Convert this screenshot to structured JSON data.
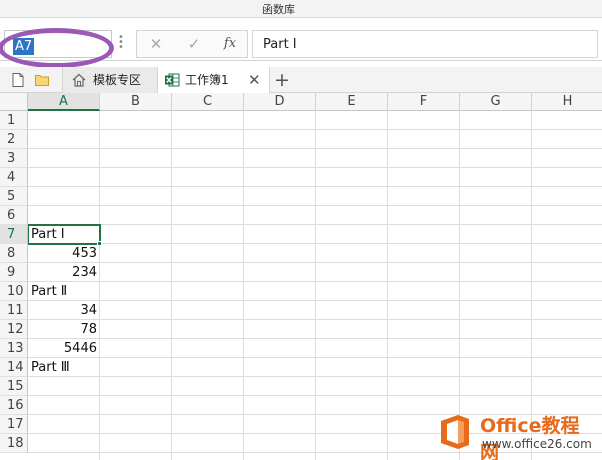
{
  "ribbon": {
    "title": "函数库"
  },
  "formula_bar": {
    "name_box": "A7",
    "more_icon": "more-vertical-icon",
    "cancel_icon": "close-icon",
    "enter_icon": "check-icon",
    "fx_label": "fx",
    "formula_value": "Part Ⅰ",
    "highlight_color": "#9b59b6"
  },
  "tabs": {
    "new_icon": "new-document-icon",
    "open_icon": "folder-icon",
    "items": [
      {
        "label": "模板专区",
        "icon": "home-icon"
      },
      {
        "label": "工作簿1",
        "icon": "excel-icon",
        "active": true
      }
    ],
    "close_label": "✕",
    "add_label": "+"
  },
  "sheet": {
    "columns": [
      "A",
      "B",
      "C",
      "D",
      "E",
      "F",
      "G",
      "H"
    ],
    "rows": [
      "1",
      "2",
      "3",
      "4",
      "5",
      "6",
      "7",
      "8",
      "9",
      "10",
      "11",
      "12",
      "13",
      "14",
      "15",
      "16",
      "17",
      "18"
    ],
    "active_column": "A",
    "active_row": "7",
    "cells": {
      "A7": "Part  Ⅰ",
      "A8": "453",
      "A9": "234",
      "A10": "Part  Ⅱ",
      "A11": "34",
      "A12": "78",
      "A13": "5446",
      "A14": "Part  Ⅲ"
    },
    "accent_color": "#217346"
  },
  "watermark": {
    "title": "Office教程网",
    "url": "www.office26.com",
    "color": "#e86a1b"
  }
}
